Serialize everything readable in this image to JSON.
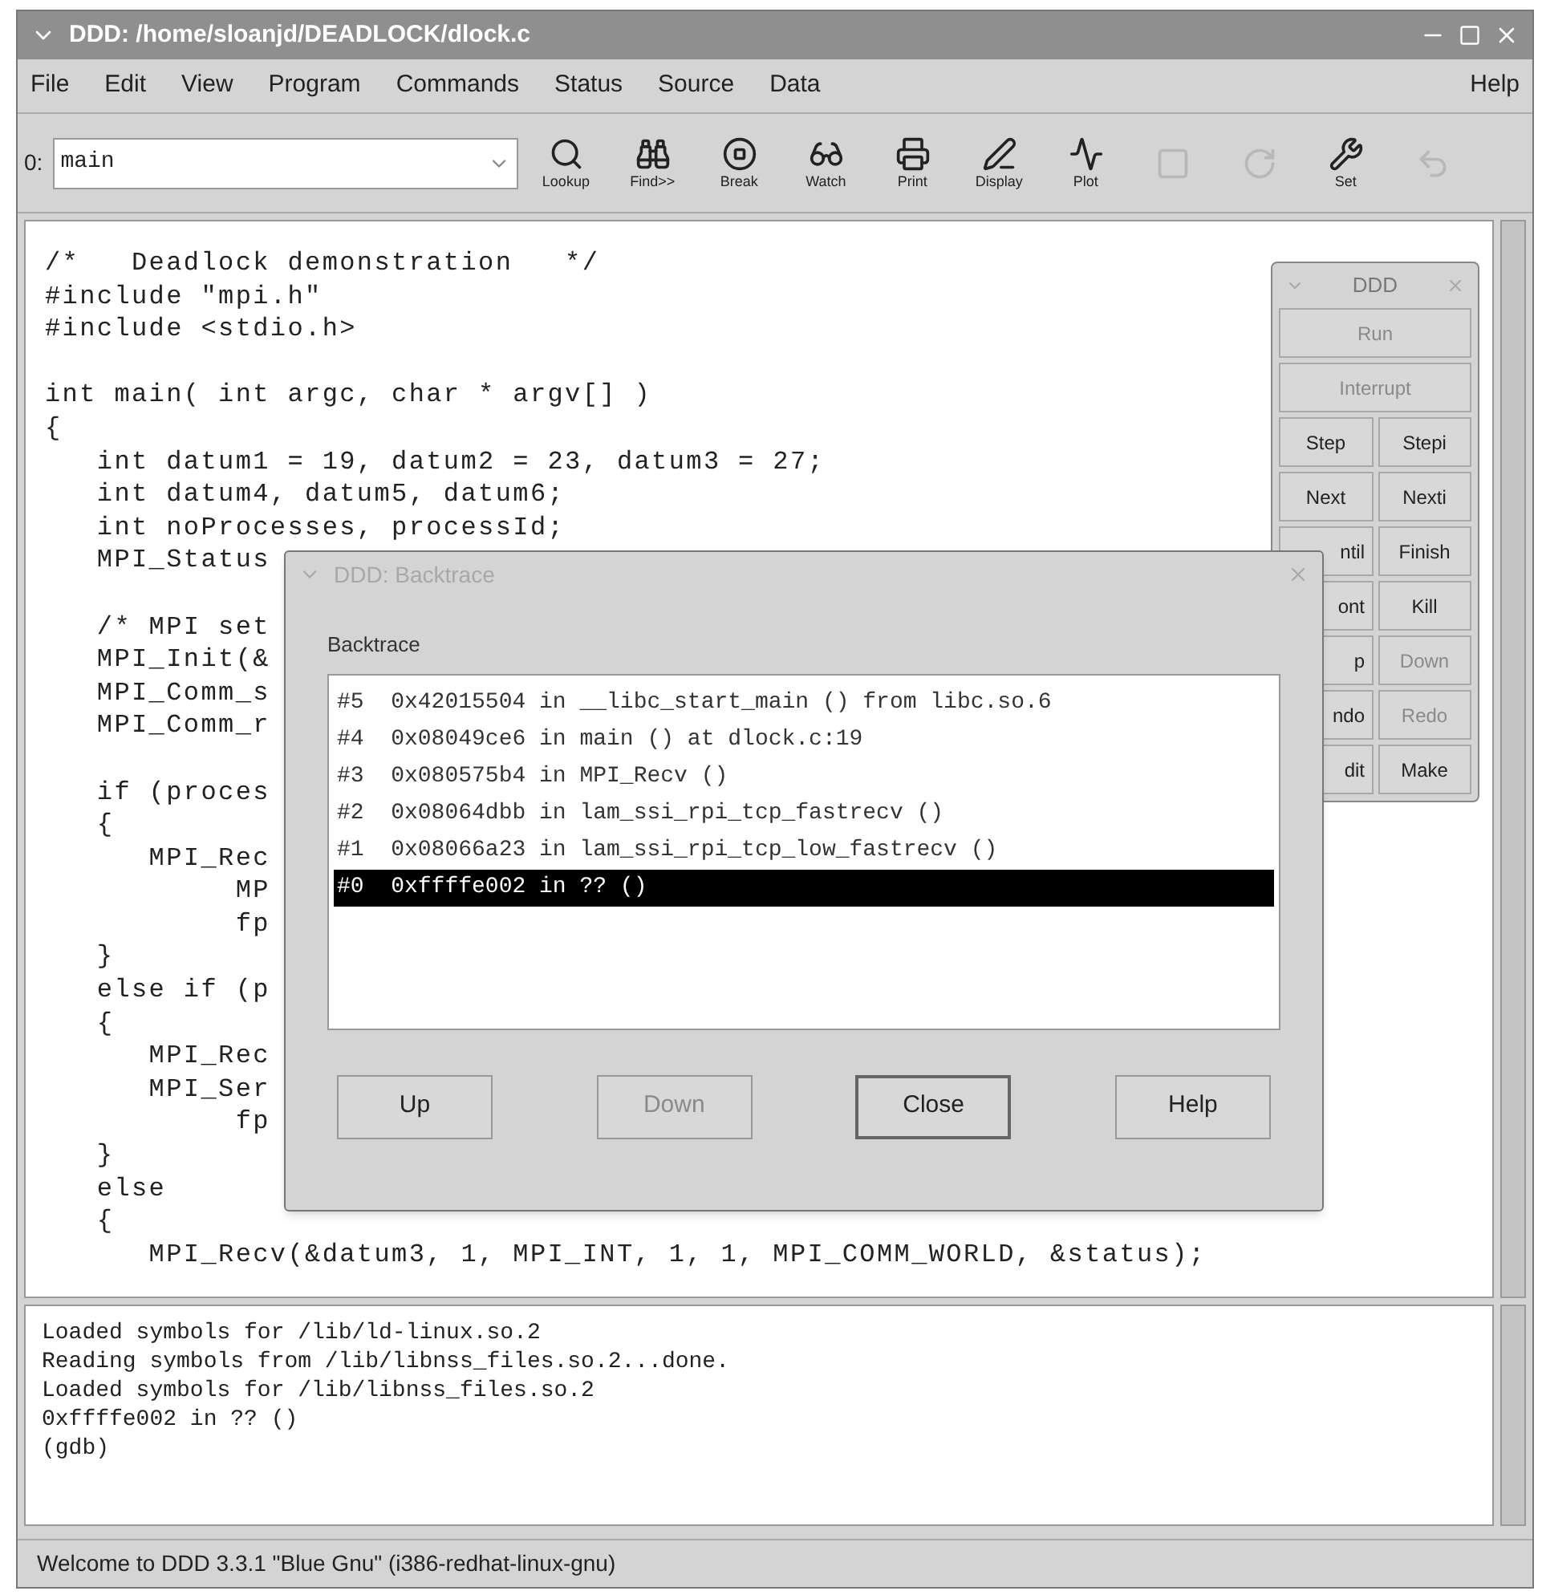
{
  "window": {
    "title": "DDD: /home/sloanjd/DEADLOCK/dlock.c"
  },
  "menu": [
    {
      "label": "File"
    },
    {
      "label": "Edit"
    },
    {
      "label": "View"
    },
    {
      "label": "Program"
    },
    {
      "label": "Commands"
    },
    {
      "label": "Status"
    },
    {
      "label": "Source"
    },
    {
      "label": "Data"
    },
    {
      "label": "Help",
      "kind": "right"
    }
  ],
  "toolbar": {
    "arg_label": "0:",
    "arg_value": "main",
    "buttons": [
      {
        "kind": "lookup",
        "label": "Lookup",
        "disabled": false
      },
      {
        "kind": "find",
        "label": "Find>>",
        "disabled": false
      },
      {
        "kind": "break",
        "label": "Break",
        "disabled": false
      },
      {
        "kind": "watch",
        "label": "Watch",
        "disabled": false
      },
      {
        "kind": "print",
        "label": "Print",
        "disabled": false
      },
      {
        "kind": "display",
        "label": "Display",
        "disabled": false
      },
      {
        "kind": "plot",
        "label": "Plot",
        "disabled": false
      },
      {
        "kind": "show",
        "disabled": true
      },
      {
        "kind": "rotate",
        "disabled": true
      },
      {
        "kind": "set",
        "label": "Set",
        "disabled": false
      },
      {
        "kind": "undisplay",
        "disabled": true
      }
    ]
  },
  "source": {
    "lines": [
      {
        "text": "/*   Deadlock demonstration   */"
      },
      {
        "text": "#include \"mpi.h\""
      },
      {
        "text": "#include <stdio.h>"
      },
      {
        "kind": "blank"
      },
      {
        "text": "int main( int argc, char * argv[] )"
      },
      {
        "text": "{"
      },
      {
        "text": "   int datum1 = 19, datum2 = 23, datum3 = 27;"
      },
      {
        "text": "   int datum4, datum5, datum6;"
      },
      {
        "text": "   int noProcesses, processId;"
      },
      {
        "text": "   MPI_Status"
      },
      {
        "kind": "blank"
      },
      {
        "text": "   /* MPI set"
      },
      {
        "text": "   MPI_Init(&"
      },
      {
        "text": "   MPI_Comm_s"
      },
      {
        "text": "   MPI_Comm_r"
      },
      {
        "kind": "blank"
      },
      {
        "text": "   if (proces"
      },
      {
        "text": "   {"
      },
      {
        "text": "      MPI_Rec"
      },
      {
        "text": "           MP"
      },
      {
        "text": "           fp"
      },
      {
        "text": "   }"
      },
      {
        "text": "   else if (p"
      },
      {
        "text": "   {"
      },
      {
        "text": "      MPI_Rec"
      },
      {
        "text": "      MPI_Ser"
      },
      {
        "text": "           fp"
      },
      {
        "text": "   }"
      },
      {
        "text": "   else"
      },
      {
        "text": "   {"
      },
      {
        "text": "      MPI_Recv(&datum3, 1, MPI_INT, 1, 1, MPI_COMM_WORLD, &status);"
      }
    ]
  },
  "command_tool": {
    "title": "DDD",
    "buttons": [
      {
        "label": "Run",
        "kind": "wide",
        "disabled": true
      },
      {
        "label": "Interrupt",
        "kind": "wide",
        "disabled": true
      },
      {
        "label": "Step",
        "kind": "half",
        "disabled": false
      },
      {
        "label": "Stepi",
        "kind": "half",
        "disabled": false
      },
      {
        "label": "Next",
        "kind": "half",
        "disabled": false
      },
      {
        "label": "Nexti",
        "kind": "half",
        "disabled": false
      },
      {
        "label": "ntil",
        "kind": "partly_hidden",
        "disabled": false
      },
      {
        "label": "Finish",
        "kind": "half",
        "disabled": false
      },
      {
        "label": "ont",
        "kind": "partly_hidden",
        "disabled": false
      },
      {
        "label": "Kill",
        "kind": "half",
        "disabled": false
      },
      {
        "label": "p",
        "kind": "partly_hidden",
        "disabled": false
      },
      {
        "label": "Down",
        "kind": "half",
        "disabled": true
      },
      {
        "label": "ndo",
        "kind": "partly_hidden",
        "disabled": false
      },
      {
        "label": "Redo",
        "kind": "half",
        "disabled": true
      },
      {
        "label": "dit",
        "kind": "partly_hidden",
        "disabled": false
      },
      {
        "label": "Make",
        "kind": "half",
        "disabled": false
      }
    ]
  },
  "backtrace_dialog": {
    "title": "DDD: Backtrace",
    "label": "Backtrace",
    "frames": [
      {
        "text": "#5  0x42015504 in __libc_start_main () from libc.so.6",
        "selected": false
      },
      {
        "text": "#4  0x08049ce6 in main () at dlock.c:19",
        "selected": false
      },
      {
        "text": "#3  0x080575b4 in MPI_Recv ()",
        "selected": false
      },
      {
        "text": "#2  0x08064dbb in lam_ssi_rpi_tcp_fastrecv ()",
        "selected": false
      },
      {
        "text": "#1  0x08066a23 in lam_ssi_rpi_tcp_low_fastrecv ()",
        "selected": false
      },
      {
        "text": "#0  0xffffe002 in ?? ()",
        "selected": true
      }
    ],
    "buttons": [
      {
        "label": "Up",
        "disabled": false,
        "default": false
      },
      {
        "label": "Down",
        "disabled": true,
        "default": false
      },
      {
        "label": "Close",
        "disabled": false,
        "default": true
      },
      {
        "label": "Help",
        "disabled": false,
        "default": false
      }
    ]
  },
  "console": {
    "lines": [
      "Loaded symbols for /lib/ld-linux.so.2",
      "Reading symbols from /lib/libnss_files.so.2...done.",
      "Loaded symbols for /lib/libnss_files.so.2",
      "0xffffe002 in ?? ()",
      "(gdb)"
    ]
  },
  "status_bar": {
    "text": "Welcome to DDD 3.3.1 \"Blue Gnu\" (i386-redhat-linux-gnu)"
  }
}
